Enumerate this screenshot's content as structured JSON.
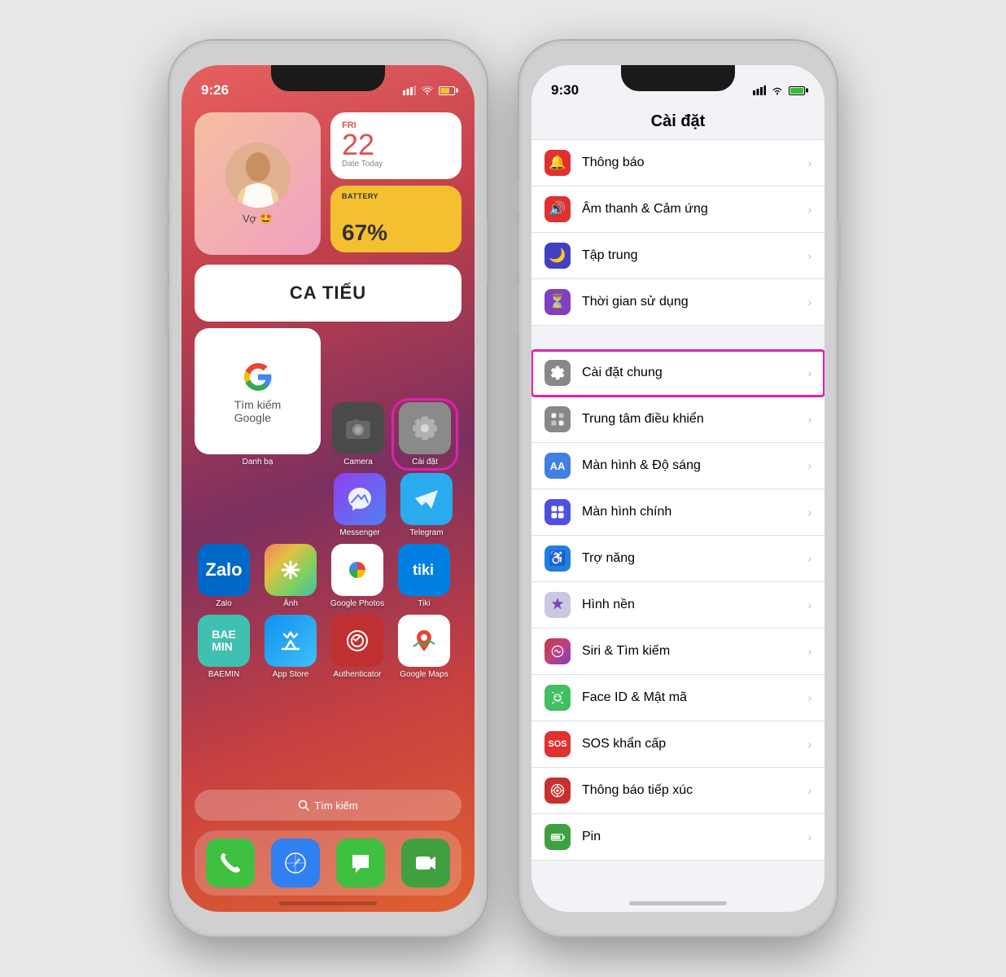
{
  "phone_left": {
    "status": {
      "time": "9:26",
      "signal": "▲▲▲",
      "wifi": "wifi",
      "battery": "yellow"
    },
    "widget_contact": {
      "name": "Vợ 🤩"
    },
    "widget_date": {
      "day_name": "FRI",
      "day_num": "22",
      "label": "Date Today"
    },
    "widget_battery": {
      "label": "BATTERY",
      "percent": "67%"
    },
    "widget_catiêu": {
      "text": "CA TIẾU"
    },
    "widget_google_label": "Danh bạ",
    "widget_google_text": "Tìm kiếm\nGoogle",
    "apps": [
      {
        "label": "Google",
        "bg": "#ffffff",
        "emoji": "G"
      },
      {
        "label": "Camera",
        "bg": "#555555",
        "emoji": "📷"
      },
      {
        "label": "Cài đặt",
        "bg": "#888888",
        "emoji": "⚙️",
        "highlighted": true
      }
    ],
    "apps_row2": [
      {
        "label": "Messenger",
        "bg": "#5060f0",
        "emoji": "💬"
      },
      {
        "label": "Telegram",
        "bg": "#30a8e0",
        "emoji": "✈️"
      }
    ],
    "apps_row3": [
      {
        "label": "Zalo",
        "bg": "#0068c8",
        "emoji": "Z"
      },
      {
        "label": "Ảnh",
        "bg": "linear-gradient(135deg,#f08080,#e0d060,#a0e060,#60d0a0)",
        "emoji": "🌸"
      },
      {
        "label": "Google Photos",
        "bg": "#ffffff",
        "emoji": "🎨"
      },
      {
        "label": "Tiki",
        "bg": "#0080e0",
        "emoji": "tiki"
      }
    ],
    "apps_row4": [
      {
        "label": "BAEMIN",
        "bg": "#40c0b0",
        "text": "BAE\nMIN"
      },
      {
        "label": "App Store",
        "bg": "#4080f0",
        "emoji": "🅐"
      },
      {
        "label": "Authenticator",
        "bg": "#c03030",
        "emoji": "🔐"
      },
      {
        "label": "Google Maps",
        "bg": "#ffffff",
        "emoji": "🗺️"
      }
    ],
    "search_placeholder": "Tìm kiếm",
    "dock": [
      {
        "label": "Phone",
        "bg": "#40c040",
        "emoji": "📞"
      },
      {
        "label": "Safari",
        "bg": "#3080f0",
        "emoji": "🧭"
      },
      {
        "label": "Messages",
        "bg": "#40c040",
        "emoji": "💬"
      },
      {
        "label": "Facetime",
        "bg": "#40a040",
        "emoji": "📱"
      }
    ]
  },
  "phone_right": {
    "status": {
      "time": "9:30",
      "battery": "green"
    },
    "title": "Cài đặt",
    "settings": [
      {
        "label": "Thông báo",
        "icon_bg": "#e03030",
        "icon": "🔔"
      },
      {
        "label": "Âm thanh & Cảm ứng",
        "icon_bg": "#e03030",
        "icon": "🔊"
      },
      {
        "label": "Tập trung",
        "icon_bg": "#4040c0",
        "icon": "🌙"
      },
      {
        "label": "Thời gian sử dụng",
        "icon_bg": "#8040c0",
        "icon": "⏳"
      },
      {
        "label": "Cài đặt chung",
        "icon_bg": "#888888",
        "icon": "⚙️",
        "highlighted": true
      },
      {
        "label": "Trung tâm điều khiển",
        "icon_bg": "#888888",
        "icon": "⚙"
      },
      {
        "label": "Màn hình & Độ sáng",
        "icon_bg": "#4080e0",
        "icon": "AA"
      },
      {
        "label": "Màn hình chính",
        "icon_bg": "#5050e0",
        "icon": "⊞"
      },
      {
        "label": "Trợ năng",
        "icon_bg": "#2080e0",
        "icon": "♿"
      },
      {
        "label": "Hình nền",
        "icon_bg": "#e0e0f0",
        "icon": "✳"
      },
      {
        "label": "Siri & Tìm kiếm",
        "icon_bg": "#c04040",
        "icon": "◎"
      },
      {
        "label": "Face ID & Mật mã",
        "icon_bg": "#40c060",
        "icon": "🙂"
      },
      {
        "label": "SOS khẩn cấp",
        "icon_bg": "#e03030",
        "icon": "SOS"
      },
      {
        "label": "Thông báo tiếp xúc",
        "icon_bg": "#c83030",
        "icon": "✳"
      },
      {
        "label": "Pin",
        "icon_bg": "#40a040",
        "icon": "▬"
      }
    ]
  }
}
